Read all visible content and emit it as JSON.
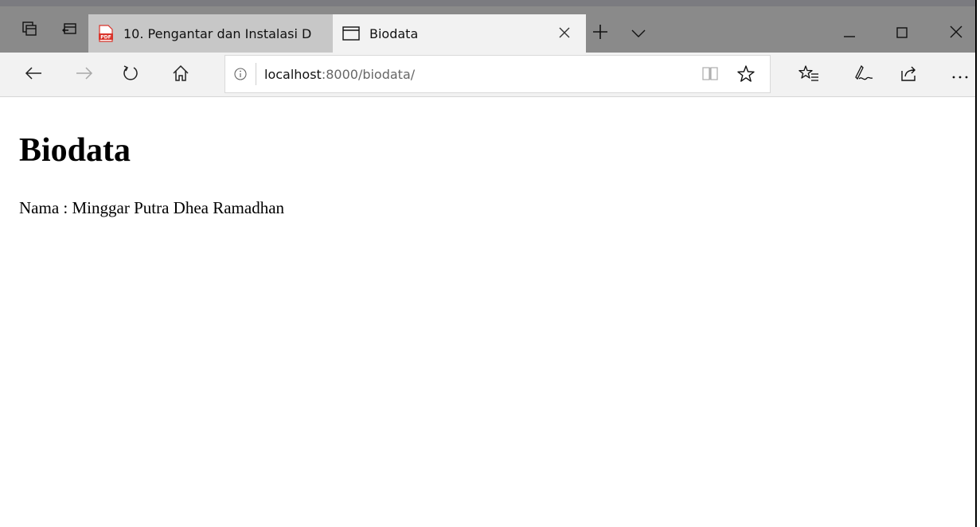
{
  "tabs": [
    {
      "title": "10. Pengantar dan Instalasi D",
      "icon": "pdf-icon",
      "active": false
    },
    {
      "title": "Biodata",
      "icon": "page-icon",
      "active": true
    }
  ],
  "address": {
    "host": "localhost",
    "path": ":8000/biodata/"
  },
  "page": {
    "heading": "Biodata",
    "label": "Nama",
    "separator": " : ",
    "value": "Minggar Putra Dhea Ramadhan"
  },
  "colors": {
    "tabbar": "#8a8a8a",
    "inactive_tab": "#c7c7c7",
    "active_tab": "#f2f2f2",
    "toolbar": "#f2f2f2",
    "pdf_red": "#d9342b"
  }
}
